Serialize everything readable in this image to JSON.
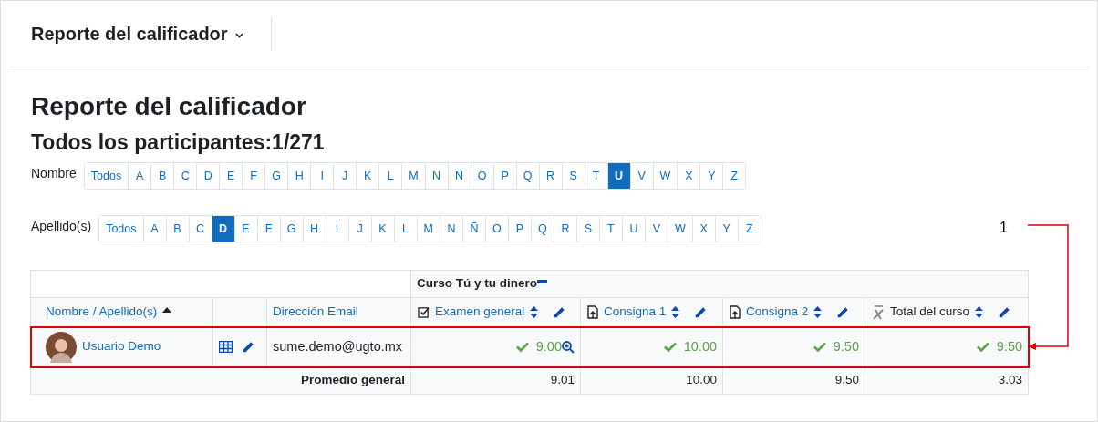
{
  "header": {
    "title": "Reporte del calificador"
  },
  "page": {
    "title": "Reporte del calificador",
    "subtitle": "Todos los participantes:1/271"
  },
  "filters": [
    {
      "label": "Nombre",
      "letters": [
        {
          "label": "Todos",
          "selected": false
        },
        {
          "label": "A",
          "selected": false
        },
        {
          "label": "B",
          "selected": false
        },
        {
          "label": "C",
          "selected": false
        },
        {
          "label": "D",
          "selected": false
        },
        {
          "label": "E",
          "selected": false
        },
        {
          "label": "F",
          "selected": false
        },
        {
          "label": "G",
          "selected": false
        },
        {
          "label": "H",
          "selected": false
        },
        {
          "label": "I",
          "selected": false
        },
        {
          "label": "J",
          "selected": false
        },
        {
          "label": "K",
          "selected": false
        },
        {
          "label": "L",
          "selected": false
        },
        {
          "label": "M",
          "selected": false
        },
        {
          "label": "N",
          "selected": false
        },
        {
          "label": "Ñ",
          "selected": false
        },
        {
          "label": "O",
          "selected": false
        },
        {
          "label": "P",
          "selected": false
        },
        {
          "label": "Q",
          "selected": false
        },
        {
          "label": "R",
          "selected": false
        },
        {
          "label": "S",
          "selected": false
        },
        {
          "label": "T",
          "selected": false
        },
        {
          "label": "U",
          "selected": true
        },
        {
          "label": "V",
          "selected": false
        },
        {
          "label": "W",
          "selected": false
        },
        {
          "label": "X",
          "selected": false
        },
        {
          "label": "Y",
          "selected": false
        },
        {
          "label": "Z",
          "selected": false
        }
      ]
    },
    {
      "label": "Apellido(s)",
      "letters": [
        {
          "label": "Todos",
          "selected": false
        },
        {
          "label": "A",
          "selected": false
        },
        {
          "label": "B",
          "selected": false
        },
        {
          "label": "C",
          "selected": false
        },
        {
          "label": "D",
          "selected": true
        },
        {
          "label": "E",
          "selected": false
        },
        {
          "label": "F",
          "selected": false
        },
        {
          "label": "G",
          "selected": false
        },
        {
          "label": "H",
          "selected": false
        },
        {
          "label": "I",
          "selected": false
        },
        {
          "label": "J",
          "selected": false
        },
        {
          "label": "K",
          "selected": false
        },
        {
          "label": "L",
          "selected": false
        },
        {
          "label": "M",
          "selected": false
        },
        {
          "label": "N",
          "selected": false
        },
        {
          "label": "Ñ",
          "selected": false
        },
        {
          "label": "O",
          "selected": false
        },
        {
          "label": "P",
          "selected": false
        },
        {
          "label": "Q",
          "selected": false
        },
        {
          "label": "R",
          "selected": false
        },
        {
          "label": "S",
          "selected": false
        },
        {
          "label": "T",
          "selected": false
        },
        {
          "label": "U",
          "selected": false
        },
        {
          "label": "V",
          "selected": false
        },
        {
          "label": "W",
          "selected": false
        },
        {
          "label": "X",
          "selected": false
        },
        {
          "label": "Y",
          "selected": false
        },
        {
          "label": "Z",
          "selected": false
        }
      ]
    }
  ],
  "table": {
    "group_header": "Curso Tú y tu dinero",
    "name_column": "Nombre / Apellido(s)",
    "email_column": "Dirección Email",
    "grade_columns": [
      {
        "label": "Examen general",
        "kind": "quiz"
      },
      {
        "label": "Consigna 1",
        "kind": "assignment"
      },
      {
        "label": "Consigna 2",
        "kind": "assignment"
      },
      {
        "label": "Total del curso",
        "kind": "total"
      }
    ],
    "rows": [
      {
        "name": "Usuario Demo",
        "email": "sume.demo@ugto.mx",
        "highlighted": true,
        "grades": [
          {
            "value": "9.00",
            "analysis": true
          },
          {
            "value": "10.00",
            "analysis": false
          },
          {
            "value": "9.50",
            "analysis": false
          },
          {
            "value": "9.50",
            "analysis": false
          }
        ]
      }
    ],
    "average": {
      "label": "Promedio general",
      "values": [
        "9.01",
        "10.00",
        "9.50",
        "3.03"
      ]
    }
  },
  "annotation": {
    "label": "1"
  }
}
